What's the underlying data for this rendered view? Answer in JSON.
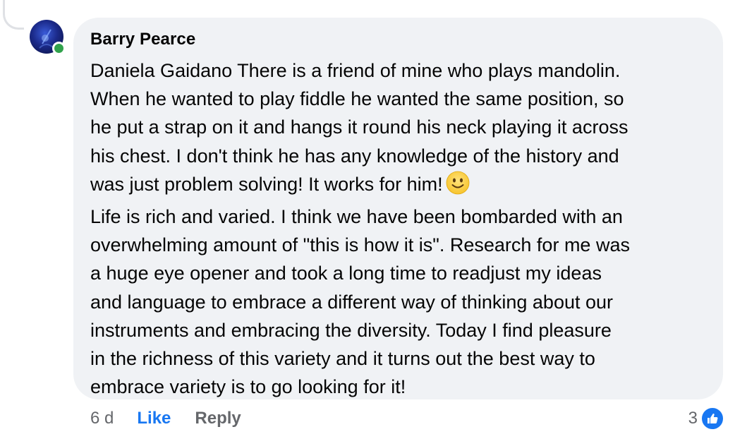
{
  "comment": {
    "author": "Barry Pearce",
    "lines": [
      "Daniela Gaidano There is a friend of mine who plays mandolin.",
      "When he wanted to play fiddle he wanted the same position, so",
      "he put a strap on it and hangs it round his neck playing it across",
      "his chest. I don't think he has any knowledge of the history and",
      "was just problem solving! It works for him!",
      "Life is rich and varied. I think we have been bombarded with an",
      "overwhelming amount of \"this is how it is\". Research for me was",
      "a huge eye opener and took a long time to readjust my ideas",
      "and language to embrace a different way of thinking about our",
      "instruments and embracing the diversity. Today I find pleasure",
      "in the richness of this variety and it turns out the best way to",
      "embrace variety is to go looking for it!"
    ],
    "emoji": "slightly-smiling-face"
  },
  "actions": {
    "time": "6 d",
    "like_label": "Like",
    "reply_label": "Reply"
  },
  "reactions": {
    "count": "3",
    "type": "like-icon"
  },
  "colors": {
    "bubble": "#f0f2f5",
    "link_blue": "#1877f2",
    "secondary_text": "#65676b",
    "online": "#31a24c"
  }
}
